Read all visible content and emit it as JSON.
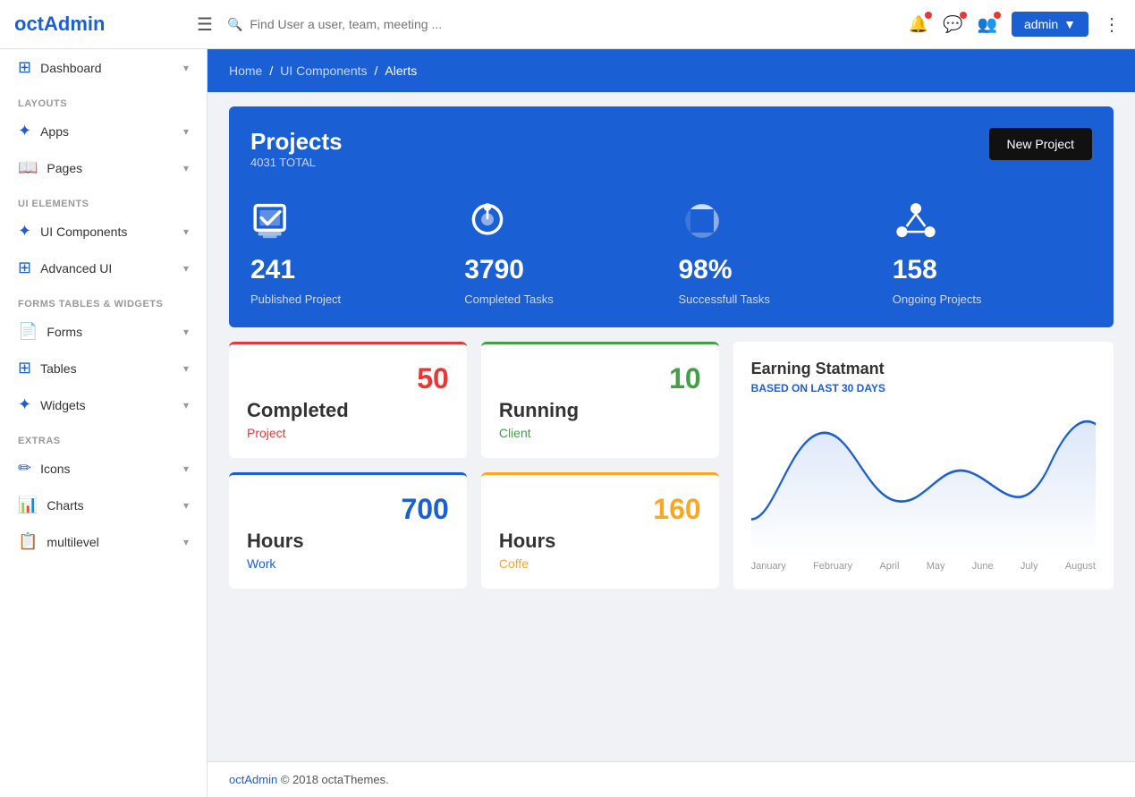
{
  "app": {
    "name": "octAdmin",
    "logo_color": "#1a5fd4"
  },
  "topnav": {
    "hamburger_label": "☰",
    "search_placeholder": "Find User a user, team, meeting ...",
    "admin_label": "admin",
    "admin_arrow": "▼",
    "dots_label": "⋮"
  },
  "breadcrumb": {
    "home": "Home",
    "sep1": "/",
    "ui_components": "UI Components",
    "sep2": "/",
    "current": "Alerts"
  },
  "sidebar": {
    "section_layouts": "LAYOUTS",
    "section_ui_elements": "UI ELEMENTS",
    "section_forms": "FORMS TABLES & WIDGETS",
    "section_extras": "EXTRAS",
    "items": [
      {
        "label": "Dashboard",
        "icon": "⊞",
        "has_chevron": true
      },
      {
        "label": "Apps",
        "icon": "✦",
        "has_chevron": true
      },
      {
        "label": "Pages",
        "icon": "📖",
        "has_chevron": true
      },
      {
        "label": "UI Components",
        "icon": "✦",
        "has_chevron": true
      },
      {
        "label": "Advanced UI",
        "icon": "⊞",
        "has_chevron": true
      },
      {
        "label": "Forms",
        "icon": "📄",
        "has_chevron": true
      },
      {
        "label": "Tables",
        "icon": "⊞",
        "has_chevron": true
      },
      {
        "label": "Widgets",
        "icon": "✦",
        "has_chevron": true
      },
      {
        "label": "Icons",
        "icon": "✏",
        "has_chevron": true
      },
      {
        "label": "Charts",
        "icon": "📊",
        "has_chevron": true
      },
      {
        "label": "multilevel",
        "icon": "📋",
        "has_chevron": true
      }
    ]
  },
  "projects": {
    "title": "Projects",
    "total_label": "4031 TOTAL",
    "new_project_btn": "New Project",
    "stats": [
      {
        "value": "241",
        "label": "Published Project"
      },
      {
        "value": "3790",
        "label": "Completed Tasks"
      },
      {
        "value": "98%",
        "label": "Successfull Tasks"
      },
      {
        "value": "158",
        "label": "Ongoing Projects"
      }
    ]
  },
  "stat_cards": [
    {
      "number": "50",
      "title": "Completed",
      "sub": "Project",
      "color": "red"
    },
    {
      "number": "10",
      "title": "Running",
      "sub": "Client",
      "color": "green"
    },
    {
      "number": "700",
      "title": "Hours",
      "sub": "Work",
      "color": "blue"
    },
    {
      "number": "160",
      "title": "Hours",
      "sub": "Coffe",
      "color": "amber"
    }
  ],
  "earning": {
    "title": "Earning Statmant",
    "subtitle": "BASED ON LAST 30 DAYS",
    "chart_labels": [
      "January",
      "February",
      "April",
      "May",
      "June",
      "July",
      "August"
    ]
  },
  "footer": {
    "brand": "octAdmin",
    "text": " © 2018 octaThemes."
  }
}
